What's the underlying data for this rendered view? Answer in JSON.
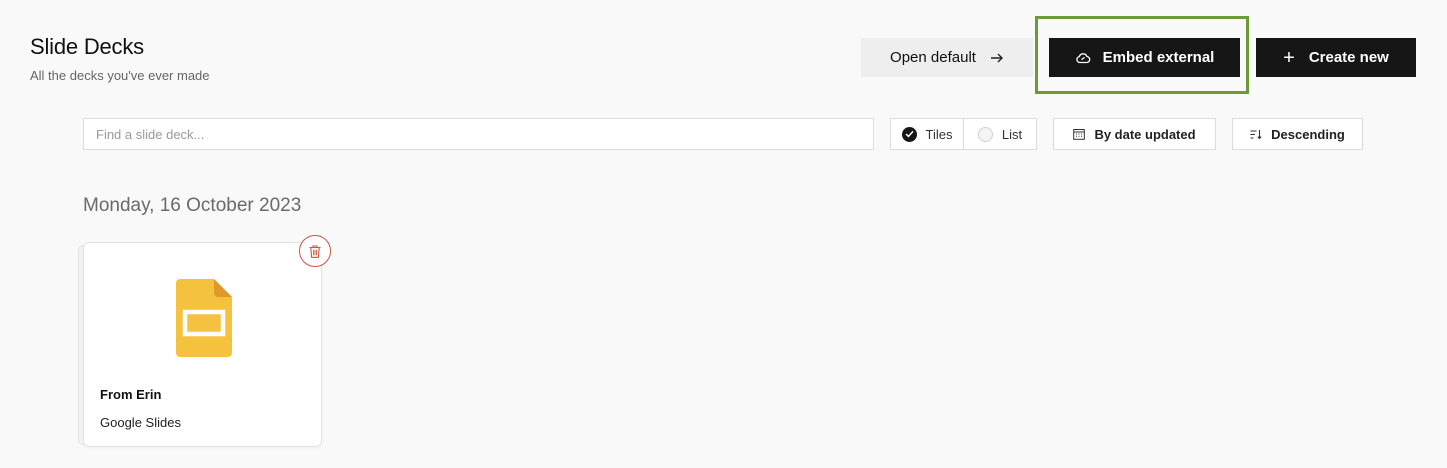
{
  "header": {
    "title": "Slide Decks",
    "subtitle": "All the decks you've ever made"
  },
  "actions": {
    "open_default_label": "Open default",
    "embed_external_label": "Embed external",
    "create_new_label": "Create new"
  },
  "filters": {
    "search_placeholder": "Find a slide deck...",
    "view_options": [
      {
        "label": "Tiles",
        "selected": true
      },
      {
        "label": "List",
        "selected": false
      }
    ],
    "sort_label": "By date updated",
    "order_label": "Descending"
  },
  "groups": [
    {
      "date": "Monday, 16 October 2023",
      "decks": [
        {
          "title": "From Erin",
          "type": "Google Slides",
          "icon": "google-slides-icon"
        }
      ]
    }
  ],
  "colors": {
    "primary_button": "#161616",
    "highlight": "#6b9a3b",
    "delete": "#d0533f",
    "slides_icon": "#f4c23f"
  }
}
